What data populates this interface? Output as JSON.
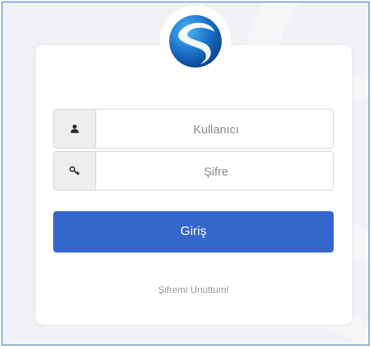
{
  "login": {
    "username_placeholder": "Kullanıcı",
    "password_placeholder": "Şifre",
    "username_value": "",
    "password_value": "",
    "submit_label": "Giriş",
    "forgot_label": "Şifremi Unuttum!"
  },
  "icons": {
    "logo": "s-swoosh-logo",
    "username": "user-icon",
    "password": "key-icon"
  },
  "colors": {
    "frame_border": "#3a78c2",
    "background": "#eff1f4",
    "button": "#3566cc",
    "button_text": "#ffffff",
    "link": "#9a9a9a"
  }
}
